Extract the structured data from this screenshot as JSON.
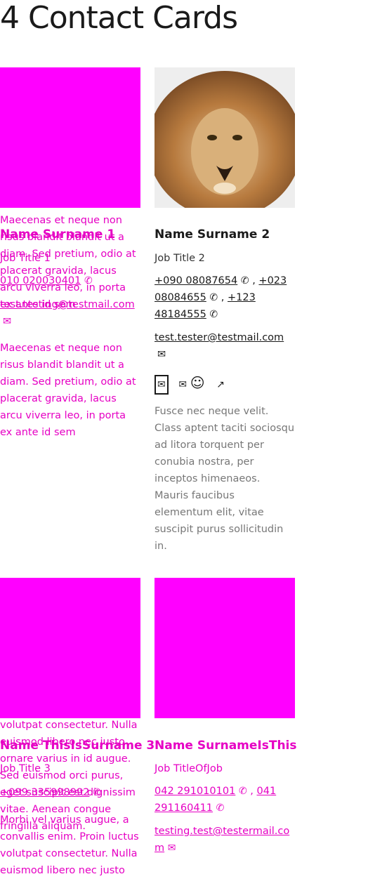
{
  "page": {
    "title": "4 Contact Cards"
  },
  "cards": [
    {
      "name": "Name Surname 1",
      "job": "Job Title 1",
      "phone": "010 020030401",
      "email": "test.testing@testmail.com",
      "desc": "Maecenas et neque non risus blandit blandit ut a diam. Sed pretium, odio at placerat gravida, lacus arcu viverra leo, in porta ex ante id sem"
    },
    {
      "name": "Name Surname 2",
      "job": "Job Title 2",
      "phones": [
        "+090 08087654",
        "+023 08084655",
        "+123 48184555"
      ],
      "email": "test.tester@testmail.com",
      "desc": "Fusce nec neque velit. Class aptent taciti sociosqu ad litora torquent per conubia nostra, per inceptos himenaeos. Mauris faucibus elementum elit, vitae suscipit purus sollicitudin in."
    },
    {
      "name": "Name ThisIsSurname 3",
      "job": "Job Title 3",
      "phone": "+099 335998992",
      "desc_a": "volutpat consectetur. Nulla euismod libero nec justo ornare varius in id augue. Sed euismod orci purus, eget suscipit est dignissim vitae. Aenean congue fringilla aliquam.",
      "desc_b": "Morbi vel varius augue, a convallis enim. Proin luctus volutpat consectetur. Nulla euismod libero nec justo"
    },
    {
      "name": "Name SurnameIsThis",
      "job": "Job TitleOfJob",
      "phones": [
        "042 291010101",
        "041 291160411"
      ],
      "email": "testing.test@testermail.com"
    }
  ],
  "lion_image": "lion-photo"
}
